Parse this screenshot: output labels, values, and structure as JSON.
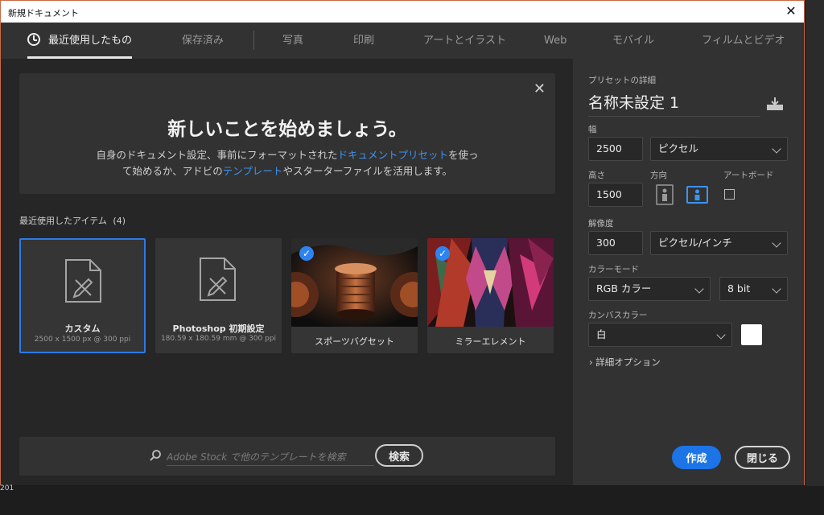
{
  "window": {
    "title": "新規ドキュメント",
    "close_glyph": "✕"
  },
  "tabs": [
    {
      "label": "最近使用したもの",
      "active": true
    },
    {
      "label": "保存済み"
    },
    {
      "label": "写真"
    },
    {
      "label": "印刷"
    },
    {
      "label": "アートとイラスト"
    },
    {
      "label": "Web"
    },
    {
      "label": "モバイル"
    },
    {
      "label": "フィルムとビデオ"
    }
  ],
  "banner": {
    "close_glyph": "✕",
    "heading": "新しいことを始めましょう。",
    "line1_a": "自身のドキュメント設定、事前にフォーマットされた",
    "line1_link": "ドキュメントプリセット",
    "line1_b": "を使っ",
    "line2_a": "て始めるか、アドビの",
    "line2_link": "テンプレート",
    "line2_b": "やスターターファイルを活用します。"
  },
  "recent": {
    "label": "最近使用したアイテム",
    "count": "(4)",
    "items": [
      {
        "name": "カスタム",
        "detail": "2500 x 1500 px @ 300 ppi",
        "selected": true
      },
      {
        "name": "Photoshop 初期設定",
        "detail": "180.59 x 180.59 mm @ 300 ppi"
      },
      {
        "name": "スポーツバグセット",
        "checked": true
      },
      {
        "name": "ミラーエレメント",
        "checked": true
      }
    ]
  },
  "search": {
    "placeholder": "Adobe Stock で他のテンプレートを検索",
    "button": "検索"
  },
  "preset": {
    "section_label": "プリセットの詳細",
    "name": "名称未設定 1",
    "width_label": "幅",
    "width_value": "2500",
    "width_unit": "ピクセル",
    "height_label": "高さ",
    "height_value": "1500",
    "orientation_label": "方向",
    "artboard_label": "アートボード",
    "resolution_label": "解像度",
    "resolution_value": "300",
    "resolution_unit": "ピクセル/インチ",
    "color_mode_label": "カラーモード",
    "color_mode": "RGB カラー",
    "bit_depth": "8 bit",
    "canvas_label": "カンバスカラー",
    "canvas_value": "白",
    "canvas_color": "#ffffff",
    "advanced": "詳細オプション",
    "create": "作成",
    "close": "閉じる"
  },
  "colors": {
    "accent": "#1c74e6",
    "link": "#3d93f0",
    "window_border": "#c96a48"
  },
  "background_text": "201"
}
